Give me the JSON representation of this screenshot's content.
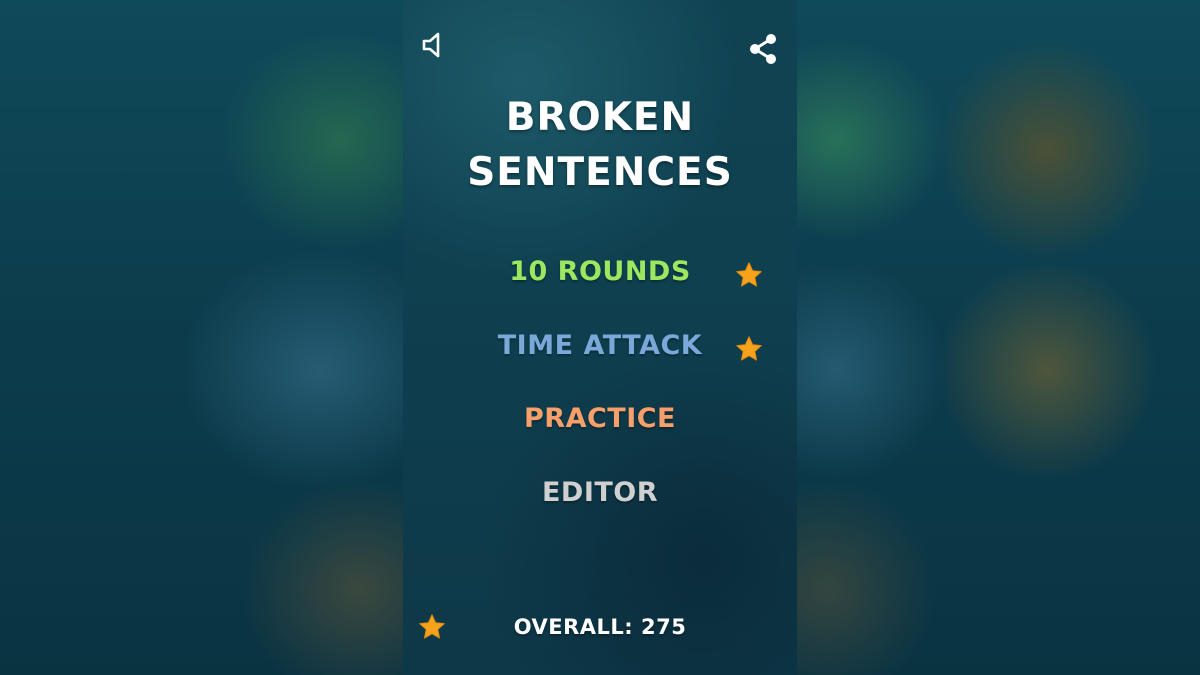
{
  "title": {
    "line1": "BROKEN",
    "line2": "SENTENCES"
  },
  "top_bar": {
    "sound_icon": "speaker-icon",
    "share_icon": "share-icon"
  },
  "menu": {
    "items": [
      {
        "label": "10 ROUNDS",
        "color": "#9be860",
        "starred": true
      },
      {
        "label": "TIME ATTACK",
        "color": "#7aa9d9",
        "starred": true
      },
      {
        "label": "PRACTICE",
        "color": "#f7a06b",
        "starred": false
      },
      {
        "label": "EDITOR",
        "color": "#d0d0d0",
        "starred": false
      }
    ]
  },
  "footer": {
    "overall_text": "OVERALL: 275",
    "star_icon": "star-icon"
  },
  "colors": {
    "star": "#f7a21b",
    "background": "#0f4050"
  }
}
